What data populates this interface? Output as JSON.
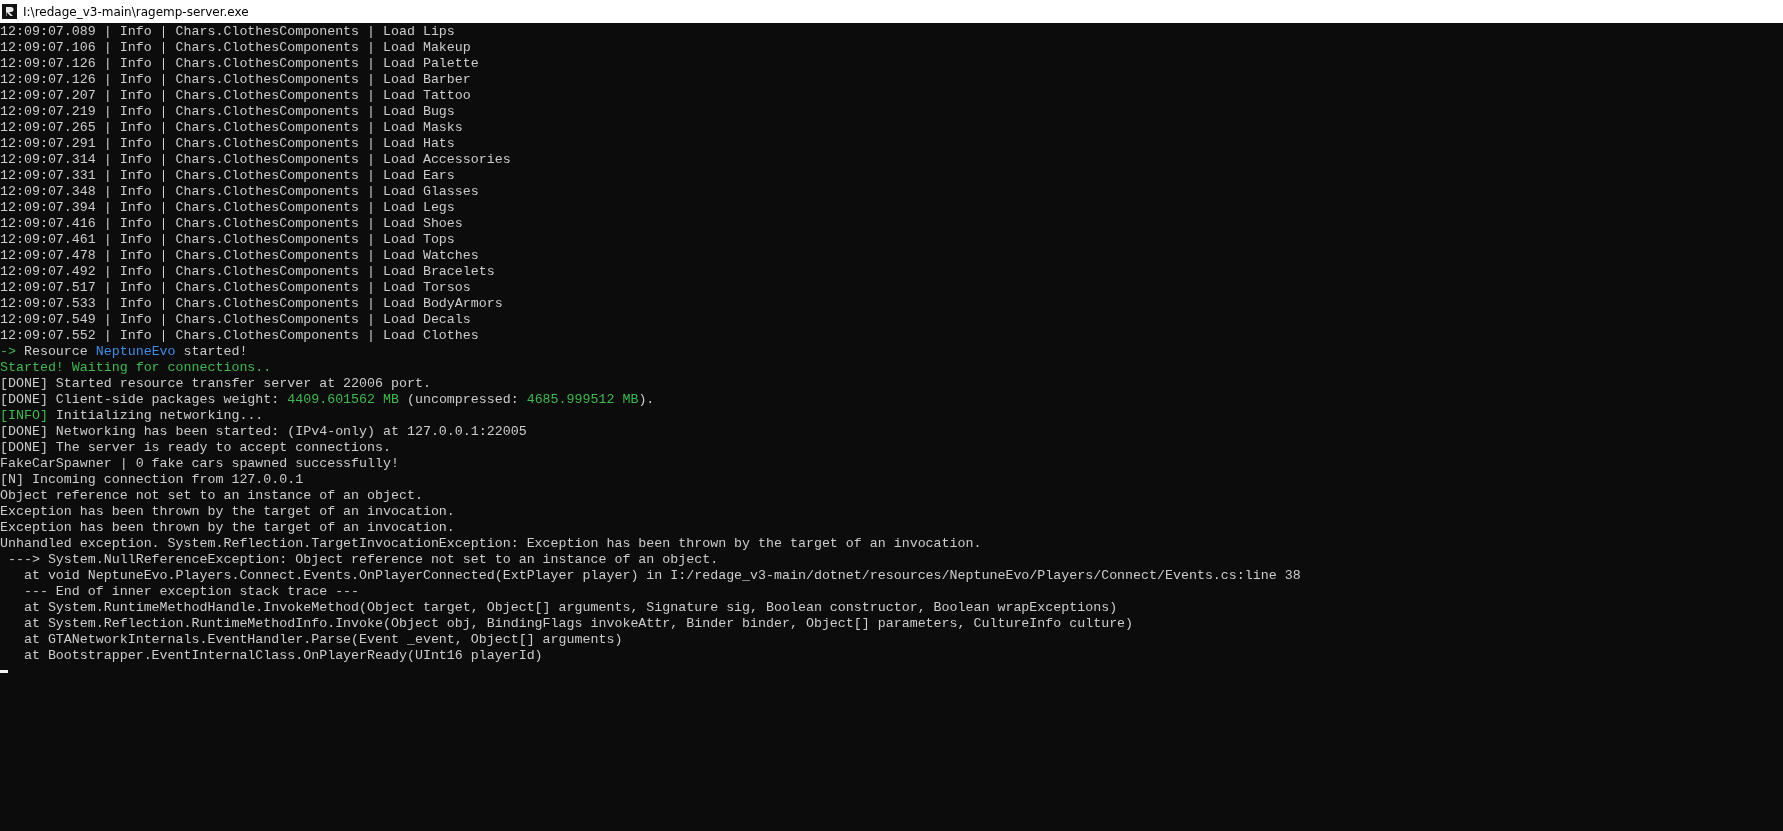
{
  "window": {
    "title": "I:\\redage_v3-main\\ragemp-server.exe"
  },
  "console": {
    "lines": [
      {
        "segments": [
          {
            "text": "12:09:07.089 | Info | Chars.ClothesComponents | Load Lips"
          }
        ]
      },
      {
        "segments": [
          {
            "text": "12:09:07.106 | Info | Chars.ClothesComponents | Load Makeup"
          }
        ]
      },
      {
        "segments": [
          {
            "text": "12:09:07.126 | Info | Chars.ClothesComponents | Load Palette"
          }
        ]
      },
      {
        "segments": [
          {
            "text": "12:09:07.126 | Info | Chars.ClothesComponents | Load Barber"
          }
        ]
      },
      {
        "segments": [
          {
            "text": "12:09:07.207 | Info | Chars.ClothesComponents | Load Tattoo"
          }
        ]
      },
      {
        "segments": [
          {
            "text": "12:09:07.219 | Info | Chars.ClothesComponents | Load Bugs"
          }
        ]
      },
      {
        "segments": [
          {
            "text": "12:09:07.265 | Info | Chars.ClothesComponents | Load Masks"
          }
        ]
      },
      {
        "segments": [
          {
            "text": "12:09:07.291 | Info | Chars.ClothesComponents | Load Hats"
          }
        ]
      },
      {
        "segments": [
          {
            "text": "12:09:07.314 | Info | Chars.ClothesComponents | Load Accessories"
          }
        ]
      },
      {
        "segments": [
          {
            "text": "12:09:07.331 | Info | Chars.ClothesComponents | Load Ears"
          }
        ]
      },
      {
        "segments": [
          {
            "text": "12:09:07.348 | Info | Chars.ClothesComponents | Load Glasses"
          }
        ]
      },
      {
        "segments": [
          {
            "text": "12:09:07.394 | Info | Chars.ClothesComponents | Load Legs"
          }
        ]
      },
      {
        "segments": [
          {
            "text": "12:09:07.416 | Info | Chars.ClothesComponents | Load Shoes"
          }
        ]
      },
      {
        "segments": [
          {
            "text": "12:09:07.461 | Info | Chars.ClothesComponents | Load Tops"
          }
        ]
      },
      {
        "segments": [
          {
            "text": "12:09:07.478 | Info | Chars.ClothesComponents | Load Watches"
          }
        ]
      },
      {
        "segments": [
          {
            "text": "12:09:07.492 | Info | Chars.ClothesComponents | Load Bracelets"
          }
        ]
      },
      {
        "segments": [
          {
            "text": "12:09:07.517 | Info | Chars.ClothesComponents | Load Torsos"
          }
        ]
      },
      {
        "segments": [
          {
            "text": "12:09:07.533 | Info | Chars.ClothesComponents | Load BodyArmors"
          }
        ]
      },
      {
        "segments": [
          {
            "text": "12:09:07.549 | Info | Chars.ClothesComponents | Load Decals"
          }
        ]
      },
      {
        "segments": [
          {
            "text": "12:09:07.552 | Info | Chars.ClothesComponents | Load Clothes"
          }
        ]
      },
      {
        "segments": [
          {
            "text": "-> ",
            "color": "#3fb950"
          },
          {
            "text": "Resource "
          },
          {
            "text": "NeptuneEvo",
            "color": "#3b8eea"
          },
          {
            "text": " started!"
          }
        ]
      },
      {
        "segments": [
          {
            "text": "Started! Waiting for connections..",
            "color": "#3fb950"
          }
        ]
      },
      {
        "segments": [
          {
            "text": "[DONE] Started resource transfer server at 22006 port."
          }
        ]
      },
      {
        "segments": [
          {
            "text": "[DONE] Client-side packages weight: "
          },
          {
            "text": "4409.601562 MB",
            "color": "#3fb950"
          },
          {
            "text": " (uncompressed: "
          },
          {
            "text": "4685.999512 MB",
            "color": "#3fb950"
          },
          {
            "text": ")."
          }
        ]
      },
      {
        "segments": [
          {
            "text": "[INFO]",
            "color": "#3fb950"
          },
          {
            "text": " Initializing networking..."
          }
        ]
      },
      {
        "segments": [
          {
            "text": "[DONE] Networking has been started: (IPv4-only) at 127.0.0.1:22005"
          }
        ]
      },
      {
        "segments": [
          {
            "text": "[DONE] The server is ready to accept connections."
          }
        ]
      },
      {
        "segments": [
          {
            "text": "FakeCarSpawner | 0 fake cars spawned successfully!"
          }
        ]
      },
      {
        "segments": [
          {
            "text": "[N] Incoming connection from 127.0.0.1"
          }
        ]
      },
      {
        "segments": [
          {
            "text": "Object reference not set to an instance of an object."
          }
        ]
      },
      {
        "segments": [
          {
            "text": "Exception has been thrown by the target of an invocation."
          }
        ]
      },
      {
        "segments": [
          {
            "text": "Exception has been thrown by the target of an invocation."
          }
        ]
      },
      {
        "segments": [
          {
            "text": "Unhandled exception. System.Reflection.TargetInvocationException: Exception has been thrown by the target of an invocation."
          }
        ]
      },
      {
        "segments": [
          {
            "text": " ---> System.NullReferenceException: Object reference not set to an instance of an object."
          }
        ]
      },
      {
        "segments": [
          {
            "text": "   at void NeptuneEvo.Players.Connect.Events.OnPlayerConnected(ExtPlayer player) in I:/redage_v3-main/dotnet/resources/NeptuneEvo/Players/Connect/Events.cs:line 38"
          }
        ]
      },
      {
        "segments": [
          {
            "text": "   --- End of inner exception stack trace ---"
          }
        ]
      },
      {
        "segments": [
          {
            "text": "   at System.RuntimeMethodHandle.InvokeMethod(Object target, Object[] arguments, Signature sig, Boolean constructor, Boolean wrapExceptions)"
          }
        ]
      },
      {
        "segments": [
          {
            "text": "   at System.Reflection.RuntimeMethodInfo.Invoke(Object obj, BindingFlags invokeAttr, Binder binder, Object[] parameters, CultureInfo culture)"
          }
        ]
      },
      {
        "segments": [
          {
            "text": "   at GTANetworkInternals.EventHandler.Parse(Event _event, Object[] arguments)"
          }
        ]
      },
      {
        "segments": [
          {
            "text": "   at Bootstrapper.EventInternalClass.OnPlayerReady(UInt16 playerId)"
          }
        ]
      }
    ]
  }
}
